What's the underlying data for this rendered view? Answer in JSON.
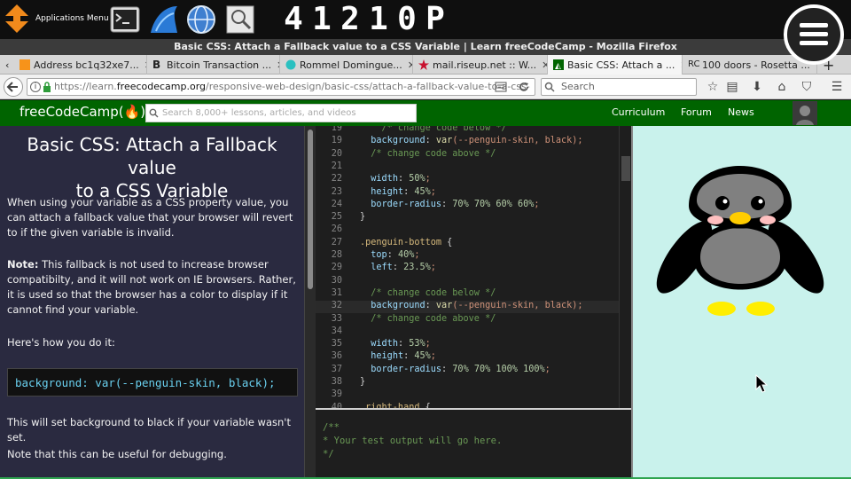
{
  "panel": {
    "apps_menu_label": "Applications Menu",
    "clock": [
      "4",
      "1",
      "2",
      "1",
      "0",
      "P"
    ],
    "launchers": [
      "terminal-icon",
      "browser-icon",
      "globe-icon",
      "search-icon"
    ]
  },
  "window": {
    "title": "Basic CSS: Attach a Fallback value to a CSS Variable | Learn freeCodeCamp - Mozilla Firefox"
  },
  "tabs": [
    {
      "label": "Address bc1q32xe7...",
      "icon": "bitcoin-icon"
    },
    {
      "label": "Bitcoin Transaction ...",
      "icon": "b-letter-icon"
    },
    {
      "label": "Rommel Domingue...",
      "icon": "chat-icon"
    },
    {
      "label": "mail.riseup.net :: W...",
      "icon": "star-icon"
    },
    {
      "label": "Basic CSS: Attach a ...",
      "icon": "fcc-icon"
    },
    {
      "label": "100 doors - Rosetta ...",
      "icon": "rosetta-icon"
    }
  ],
  "nav": {
    "url_prefix": "https://learn.",
    "url_host": "freecodecamp.org",
    "url_rest": "/responsive-web-design/basic-css/attach-a-fallback-value-to-a-css-",
    "search_placeholder": "Search"
  },
  "fcc": {
    "logo": "freeCodeCamp(🔥)",
    "search_placeholder": "Search 8,000+ lessons, articles, and videos",
    "nav": [
      "Curriculum",
      "Forum",
      "News"
    ]
  },
  "lesson": {
    "title_line1": "Basic CSS: Attach a Fallback value",
    "title_line2": "to a CSS Variable",
    "p1": "When using your variable as a CSS property value, you can attach a fallback value that your browser will revert to if the given variable is invalid.",
    "note_label": "Note:",
    "p2": " This fallback is not used to increase browser compatibilty, and it will not work on IE browsers. Rather, it is used so that the browser has a color to display if it cannot find your variable.",
    "p3": "Here's how you do it:",
    "code": "background: var(--penguin-skin, black);",
    "p4": "This will set background to black if your variable wasn't set.",
    "p5": "Note that this can be useful for debugging."
  },
  "editor": {
    "lines": [
      {
        "n": "19",
        "t": "    /* change code below */"
      },
      {
        "n": "19",
        "t": "  background: var(--penguin-skin, black);"
      },
      {
        "n": "20",
        "t": "  /* change code above */"
      },
      {
        "n": "21",
        "t": ""
      },
      {
        "n": "22",
        "t": "  width: 50%;"
      },
      {
        "n": "23",
        "t": "  height: 45%;"
      },
      {
        "n": "24",
        "t": "  border-radius: 70% 70% 60% 60%;"
      },
      {
        "n": "25",
        "t": "}"
      },
      {
        "n": "26",
        "t": ""
      },
      {
        "n": "27",
        "t": ".penguin-bottom {"
      },
      {
        "n": "28",
        "t": "  top: 40%;"
      },
      {
        "n": "29",
        "t": "  left: 23.5%;"
      },
      {
        "n": "30",
        "t": ""
      },
      {
        "n": "31",
        "t": "  /* change code below */"
      },
      {
        "n": "32",
        "t": "  background: var(--penguin-skin, black);"
      },
      {
        "n": "33",
        "t": "  /* change code above */"
      },
      {
        "n": "34",
        "t": ""
      },
      {
        "n": "35",
        "t": "  width: 53%;"
      },
      {
        "n": "36",
        "t": "  height: 45%;"
      },
      {
        "n": "37",
        "t": "  border-radius: 70% 70% 100% 100%;"
      },
      {
        "n": "38",
        "t": "}"
      },
      {
        "n": "39",
        "t": ""
      },
      {
        "n": "40",
        "t": ".right-hand {"
      }
    ],
    "current_line": 14
  },
  "output": {
    "lines": [
      "/**",
      "* Your test output will go here.",
      "*/"
    ]
  },
  "colors": {
    "fcc_green": "#006400",
    "lesson_bg": "#2a2a40",
    "editor_bg": "#1e1e1e",
    "preview_bg": "#c9f2ec"
  }
}
